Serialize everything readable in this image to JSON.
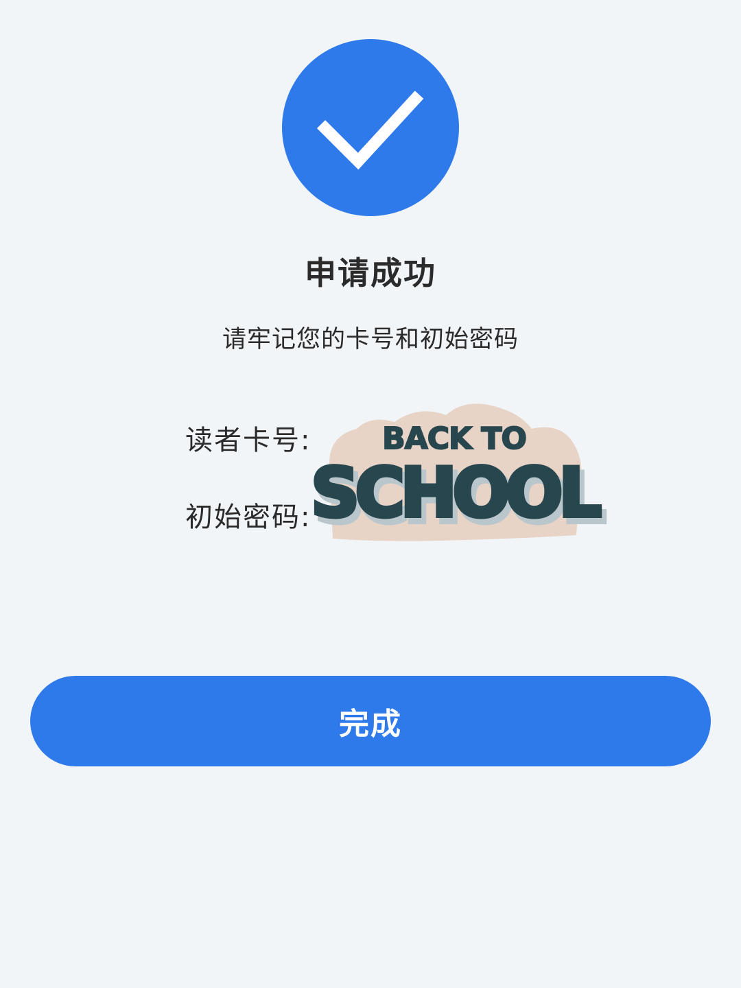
{
  "colors": {
    "accent": "#2f7aea",
    "background": "#f2f5f8",
    "text": "#2b2b2b",
    "sticker_bg": "#e8d3c7",
    "sticker_text": "#27464e"
  },
  "status": {
    "icon": "checkmark-icon",
    "title": "申请成功",
    "subtitle": "请牢记您的卡号和初始密码"
  },
  "info": {
    "card_number_label": "读者卡号:",
    "password_label": "初始密码:"
  },
  "sticker": {
    "line1": "BACK TO",
    "line2": "SCHOOL"
  },
  "actions": {
    "done_label": "完成"
  }
}
